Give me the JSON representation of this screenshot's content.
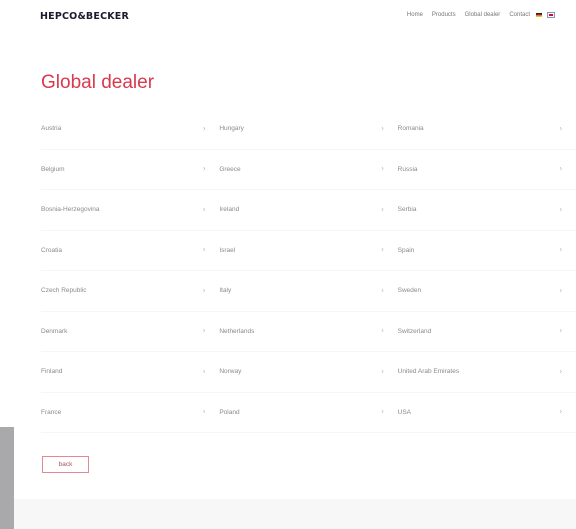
{
  "header": {
    "logo": "HEPCO&BECKER",
    "nav": [
      "Home",
      "Products",
      "Global dealer",
      "Contact"
    ]
  },
  "page": {
    "title": "Global dealer"
  },
  "columns": [
    [
      "Austria",
      "Belgium",
      "Bosnia-Herzegovina",
      "Croatia",
      "Czech Republic",
      "Denmark",
      "Finland",
      "France"
    ],
    [
      "Hungary",
      "Greece",
      "Ireland",
      "Israel",
      "Italy",
      "Netherlands",
      "Norway",
      "Poland"
    ],
    [
      "Romania",
      "Russia",
      "Serbia",
      "Spain",
      "Sweden",
      "Switzerland",
      "United Arab Emirates",
      "USA"
    ]
  ],
  "chevron": "›",
  "back_label": "back",
  "colors": {
    "accent": "#d8394d",
    "text": "#8a8a8a",
    "side_tab": "#a9a9ac"
  }
}
